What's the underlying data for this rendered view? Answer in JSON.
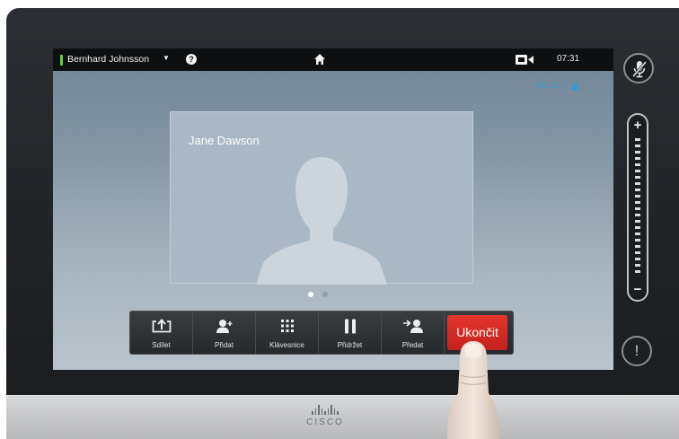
{
  "statusbar": {
    "user_name": "Bernhard Johnsson",
    "time": "07:31",
    "icons": {
      "presence": "presence-indicator",
      "dropdown": "chevron-down-icon",
      "help": "help-icon",
      "home": "home-icon",
      "camera": "camera-icon"
    }
  },
  "call": {
    "duration": "00:10",
    "encryption_icon": "lock-icon",
    "participant_name": "Jane Dawson",
    "pages": {
      "current": 1,
      "total": 2
    }
  },
  "toolbar": {
    "buttons": [
      {
        "label": "Sdílet",
        "icon": "share-icon"
      },
      {
        "label": "Přidat",
        "icon": "add-participant-icon"
      },
      {
        "label": "Klávesnice",
        "icon": "keypad-icon"
      },
      {
        "label": "Přidržet",
        "icon": "pause-icon"
      },
      {
        "label": "Předat",
        "icon": "transfer-icon"
      }
    ],
    "end_call_label": "Ukončit"
  },
  "side_controls": {
    "mute_icon": "microphone-muted-icon",
    "volume_plus": "+",
    "volume_minus": "−",
    "alert_label": "!"
  },
  "brand": {
    "logo_text": "CISCO"
  },
  "colors": {
    "end_call": "#d52a23",
    "presence": "#5fd13c",
    "timer": "#2f9bd6"
  }
}
